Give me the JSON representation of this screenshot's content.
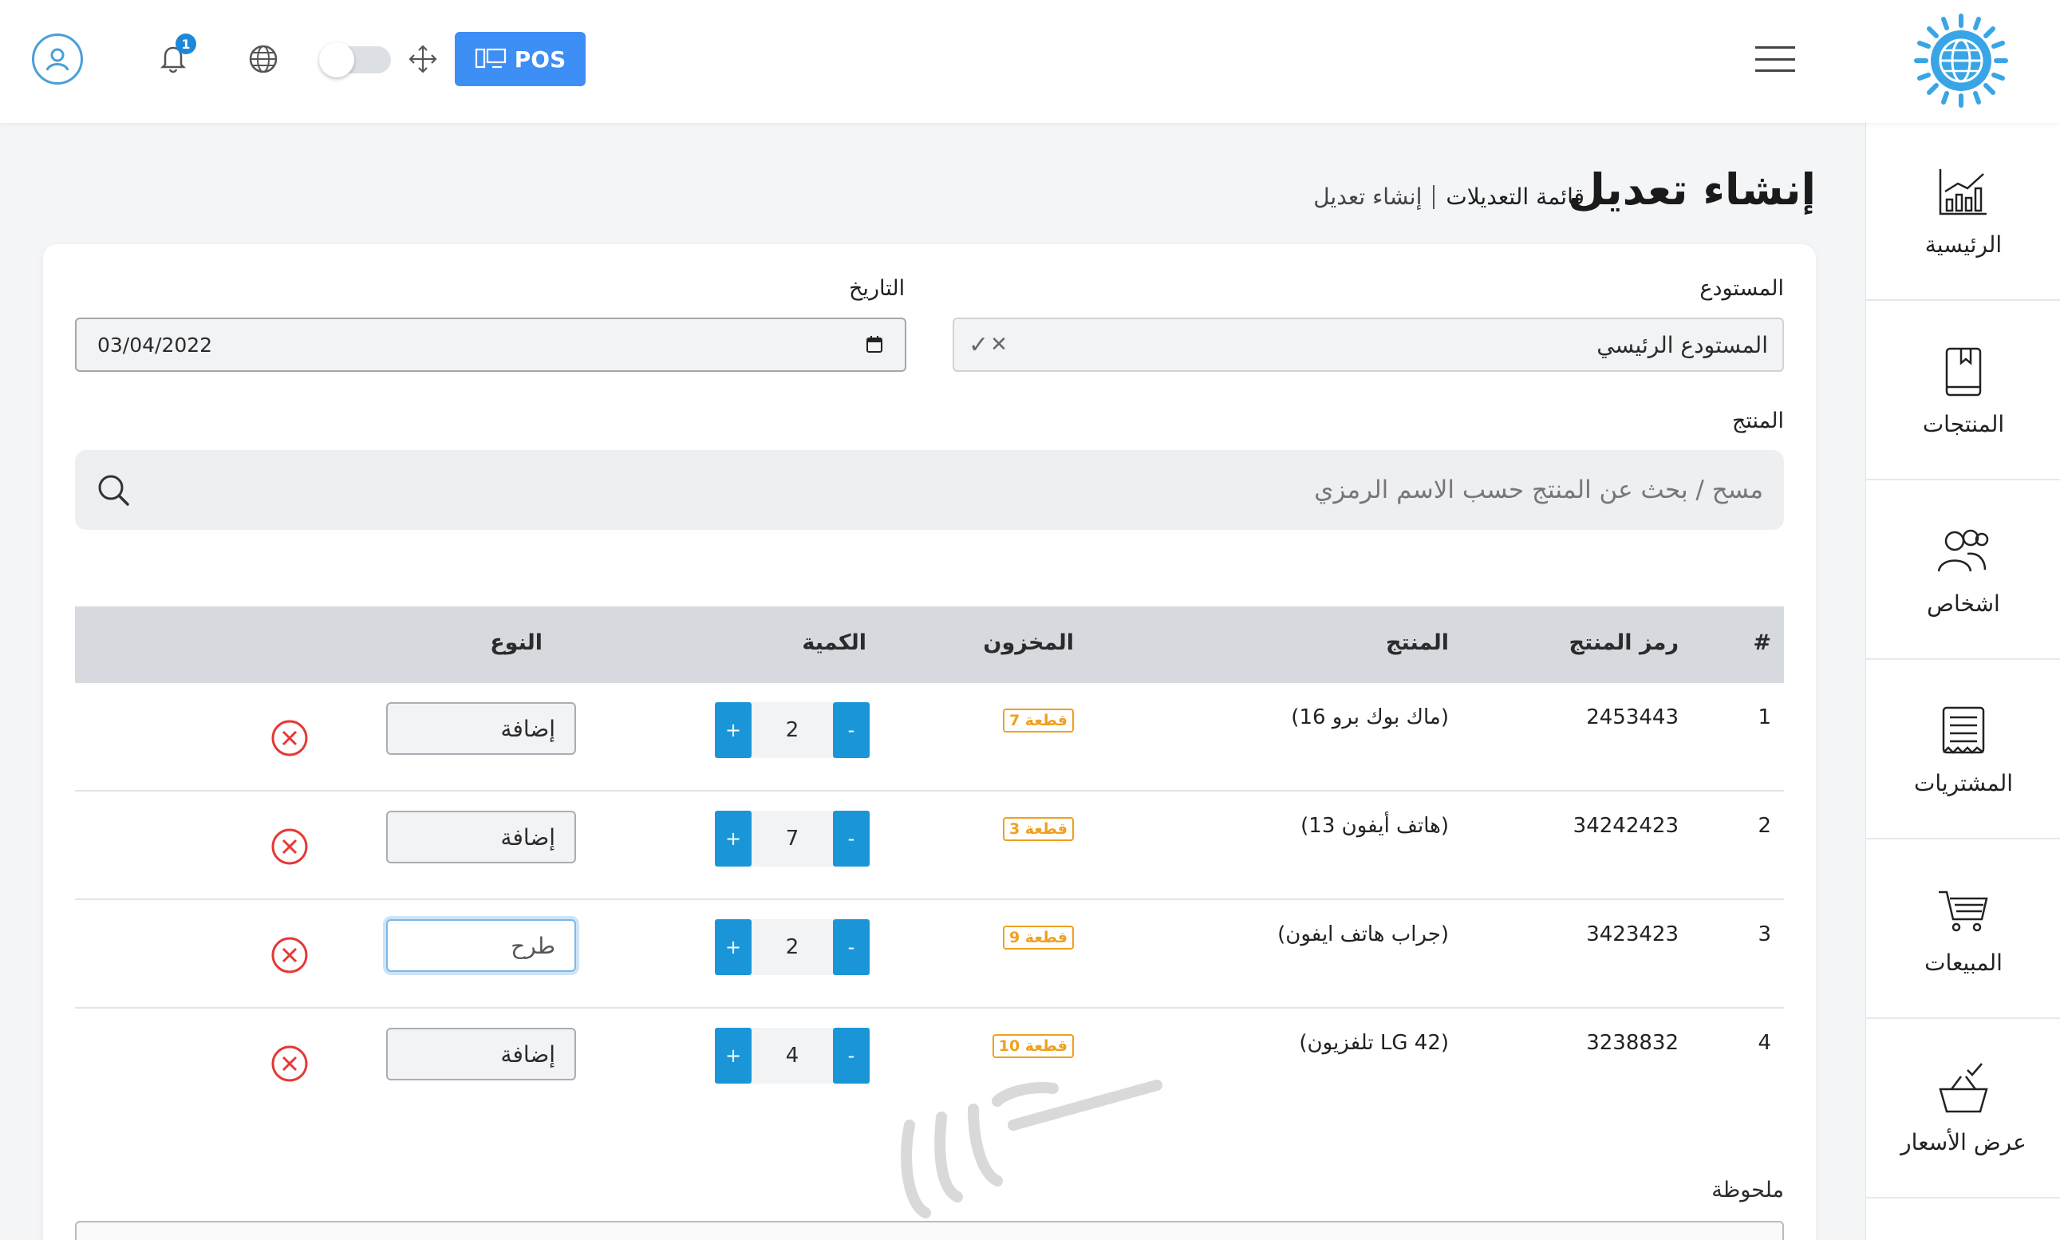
{
  "topbar": {
    "notifications_count": "1",
    "pos_label": "POS"
  },
  "sidebar": {
    "items": [
      {
        "label": "الرئيسية",
        "icon": "chart-icon"
      },
      {
        "label": "المنتجات",
        "icon": "book-icon"
      },
      {
        "label": "اشخاص",
        "icon": "people-icon"
      },
      {
        "label": "المشتريات",
        "icon": "receipt-icon"
      },
      {
        "label": "المبيعات",
        "icon": "cart-icon"
      },
      {
        "label": "عرض الأسعار",
        "icon": "basket-icon"
      }
    ]
  },
  "header": {
    "title": "إنشاء تعديل",
    "breadcrumb_parent": "قائمة التعديلات",
    "breadcrumb_current": "إنشاء تعديل"
  },
  "form": {
    "warehouse_label": "المستودع",
    "warehouse_value": "المستودع الرئيسي",
    "date_label": "التاريخ",
    "date_value": "03/04/2022",
    "product_label": "المنتج",
    "search_placeholder": "مسح / بحث عن المنتج حسب الاسم الرمزي",
    "note_label": "ملحوظة"
  },
  "table": {
    "headers": {
      "index": "#",
      "code": "رمز المنتج",
      "product": "المنتج",
      "stock": "المخزون",
      "quantity": "الكمية",
      "type": "النوع"
    },
    "rows": [
      {
        "index": "1",
        "code": "2453443",
        "product": "(ماك بوك برو 16)",
        "stock": "7 قطعة",
        "quantity": "2",
        "type": "إضافة"
      },
      {
        "index": "2",
        "code": "34242423",
        "product": "(هاتف أيفون 13)",
        "stock": "3 قطعة",
        "quantity": "7",
        "type": "إضافة"
      },
      {
        "index": "3",
        "code": "3423423",
        "product": "(جراب هاتف ايفون)",
        "stock": "9 قطعة",
        "quantity": "2",
        "type": "طرح"
      },
      {
        "index": "4",
        "code": "3238832",
        "product": "(تلفزيون LG 42)",
        "stock": "10 قطعة",
        "quantity": "4",
        "type": "إضافة"
      }
    ],
    "minus_label": "-",
    "plus_label": "+"
  },
  "colors": {
    "accent": "#3d8ef5",
    "qty_button": "#1a96d8",
    "stock_badge": "#f0a01f",
    "remove": "#e53935"
  }
}
